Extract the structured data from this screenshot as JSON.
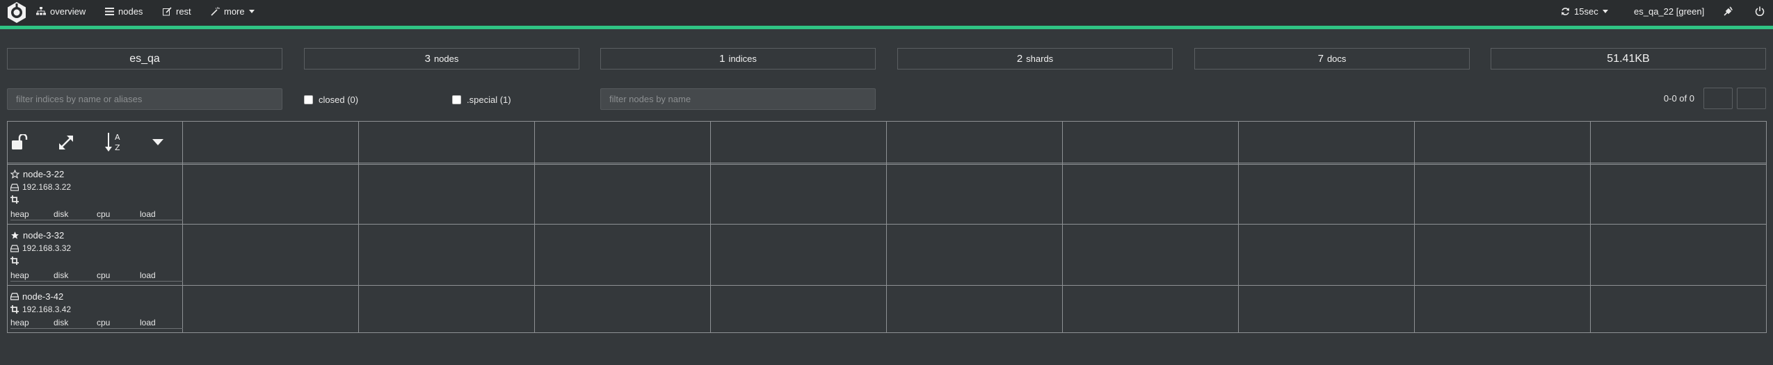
{
  "navbar": {
    "overview_label": "overview",
    "nodes_label": "nodes",
    "rest_label": "rest",
    "more_label": "more",
    "refresh_label": "15sec",
    "cluster_label": "es_qa_22 [green]"
  },
  "colors": {
    "accent": "#2fc383",
    "background": "#34383b",
    "navbar": "#2a2d2f"
  },
  "summary": {
    "cluster_name": "es_qa",
    "nodes_count": "3",
    "nodes_label": "nodes",
    "indices_count": "1",
    "indices_label": "indices",
    "shards_count": "2",
    "shards_label": "shards",
    "docs_count": "7",
    "docs_label": "docs",
    "size": "51.41KB"
  },
  "filters": {
    "indices_placeholder": "filter indices by name or aliases",
    "closed_label": "closed (0)",
    "special_label": ".special (1)",
    "nodes_placeholder": "filter nodes by name",
    "pagination": "0-0 of 0"
  },
  "header_icons": [
    "unlock-icon",
    "expand-icon",
    "sort-alpha-icon",
    "caret-down-icon"
  ],
  "nodes": [
    {
      "name": "node-3-22",
      "role_icon": "star-outline-icon",
      "ip": "192.168.3.22",
      "metrics": [
        "heap",
        "disk",
        "cpu",
        "load"
      ]
    },
    {
      "name": "node-3-32",
      "role_icon": "star-filled-icon",
      "ip": "192.168.3.32",
      "metrics": [
        "heap",
        "disk",
        "cpu",
        "load"
      ]
    },
    {
      "name": "node-3-42",
      "role_icon": "hdd-icon",
      "ip": "192.168.3.42",
      "metrics": [
        "heap",
        "disk",
        "cpu",
        "load"
      ]
    }
  ]
}
